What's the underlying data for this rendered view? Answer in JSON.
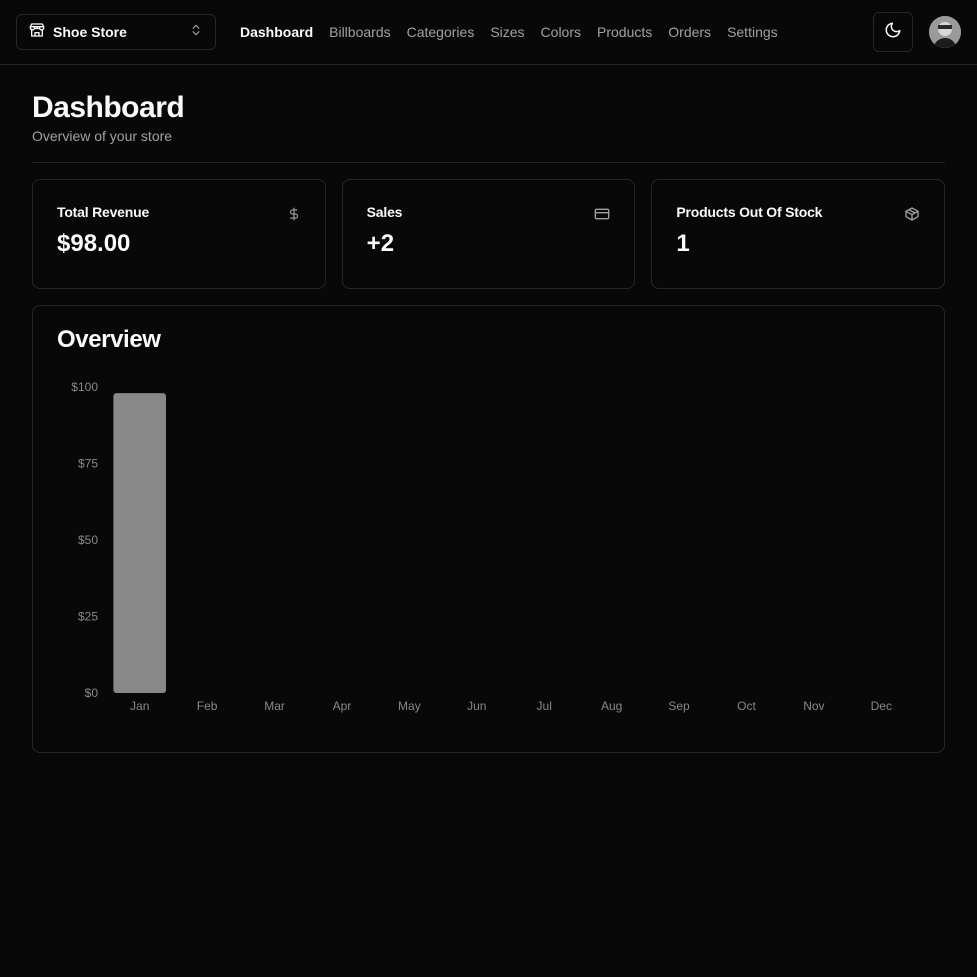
{
  "navbar": {
    "store_name": "Shoe Store",
    "links": [
      "Dashboard",
      "Billboards",
      "Categories",
      "Sizes",
      "Colors",
      "Products",
      "Orders",
      "Settings"
    ],
    "active_link": "Dashboard"
  },
  "header": {
    "title": "Dashboard",
    "subtitle": "Overview of your store"
  },
  "cards": [
    {
      "title": "Total Revenue",
      "value": "$98.00",
      "icon": "dollar-icon"
    },
    {
      "title": "Sales",
      "value": "+2",
      "icon": "credit-card-icon"
    },
    {
      "title": "Products Out Of Stock",
      "value": "1",
      "icon": "package-icon"
    }
  ],
  "overview": {
    "title": "Overview"
  },
  "chart_data": {
    "type": "bar",
    "categories": [
      "Jan",
      "Feb",
      "Mar",
      "Apr",
      "May",
      "Jun",
      "Jul",
      "Aug",
      "Sep",
      "Oct",
      "Nov",
      "Dec"
    ],
    "values": [
      98,
      0,
      0,
      0,
      0,
      0,
      0,
      0,
      0,
      0,
      0,
      0
    ],
    "ylim": [
      0,
      100
    ],
    "yticks": [
      0,
      25,
      50,
      75,
      100
    ],
    "ytick_labels": [
      "$0",
      "$25",
      "$50",
      "$75",
      "$100"
    ],
    "bar_color": "#888888",
    "grid": false
  },
  "colors": {
    "background": "#080808",
    "border": "#262626",
    "muted_text": "#a1a1a1"
  }
}
